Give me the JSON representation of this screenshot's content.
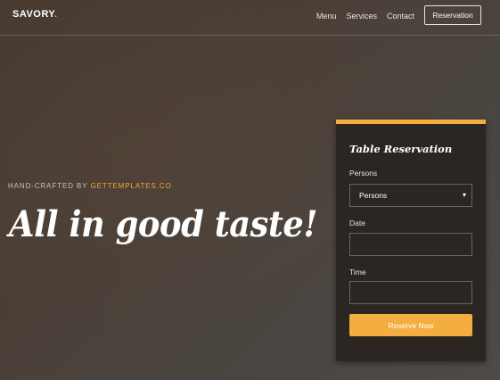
{
  "header": {
    "brand": "SAVORY",
    "brand_dot": ".",
    "nav": [
      "Menu",
      "Services",
      "Contact"
    ],
    "cta": "Reservation"
  },
  "hero": {
    "subtitle_prefix": "HAND-CRAFTED BY ",
    "subtitle_link": "GETTEMPLATES.CO",
    "title": "All in good taste!"
  },
  "reservation": {
    "title": "Table Reservation",
    "persons_label": "Persons",
    "persons_selected": "Persons",
    "date_label": "Date",
    "date_value": "",
    "time_label": "Time",
    "time_value": "",
    "submit": "Reserve Now"
  },
  "colors": {
    "accent": "#f4ad3f",
    "card_bg": "#2c2622",
    "background": "#4a3f37"
  },
  "icons": {
    "select_chevron": "chevron-down-icon"
  }
}
